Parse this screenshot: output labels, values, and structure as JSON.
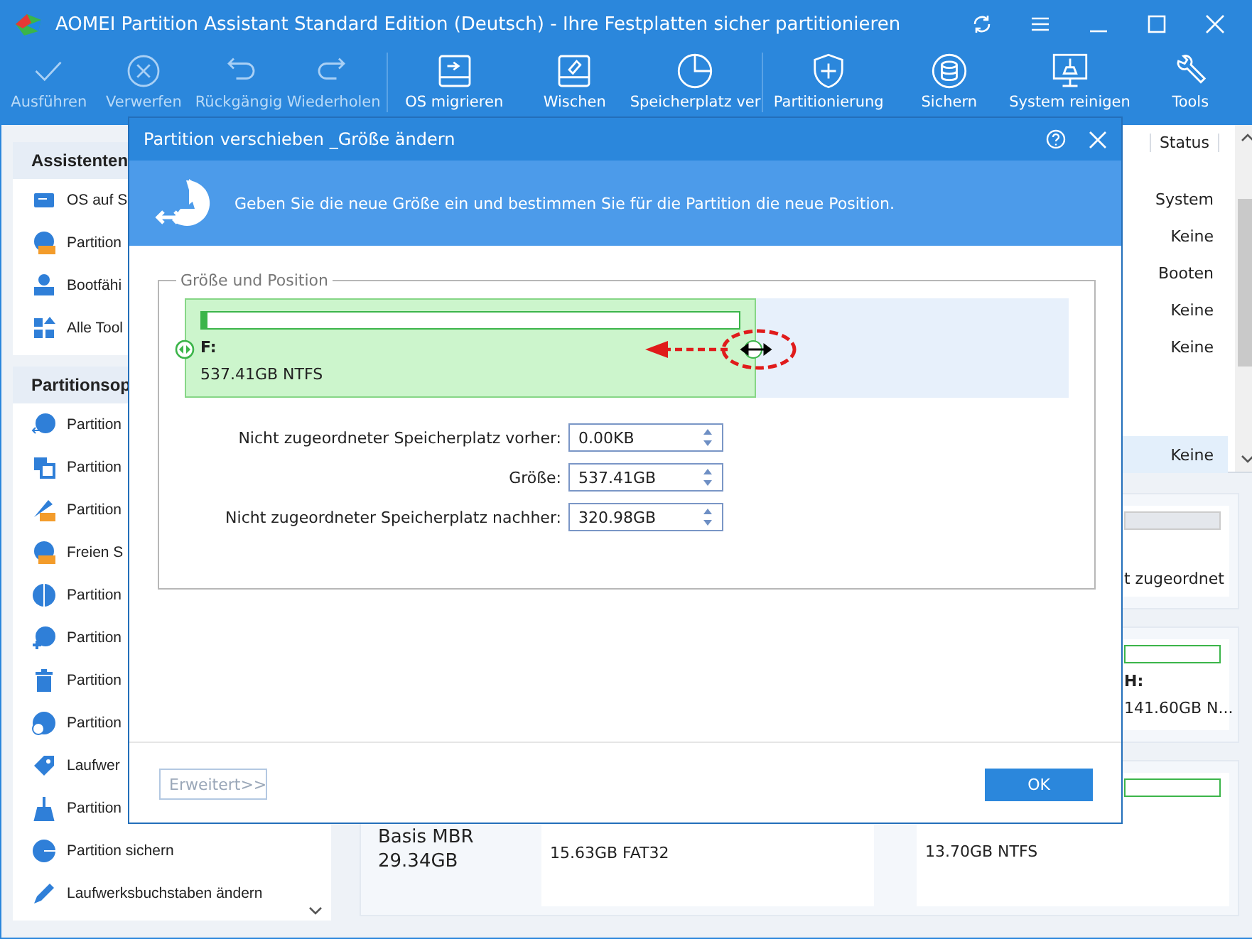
{
  "window": {
    "title": "AOMEI Partition Assistant Standard Edition (Deutsch) - Ihre Festplatten sicher partitionieren"
  },
  "toolbar": [
    {
      "label": "Ausführen",
      "disabled": true
    },
    {
      "label": "Verwerfen",
      "disabled": true
    },
    {
      "label": "Rückgängig",
      "disabled": true
    },
    {
      "label": "Wiederholen",
      "disabled": true
    },
    {
      "label": "OS migrieren",
      "disabled": false
    },
    {
      "label": "Wischen",
      "disabled": false
    },
    {
      "label": "Speicherplatz ver",
      "disabled": false
    },
    {
      "label": "Partitionierung",
      "disabled": false
    },
    {
      "label": "Sichern",
      "disabled": false
    },
    {
      "label": "System reinigen",
      "disabled": false
    },
    {
      "label": "Tools",
      "disabled": false
    }
  ],
  "sidebar": [
    {
      "title": "Assistenten",
      "items": [
        "OS auf S",
        "Partition",
        "Bootfähi",
        "Alle Tool"
      ]
    },
    {
      "title": "Partitionsop",
      "items": [
        "Partition",
        "Partition",
        "Partition",
        "Freien S",
        "Partition",
        "Partition",
        "Partition",
        "Partition",
        "Laufwer",
        "Partition",
        "Partition sichern",
        "Laufwerksbuchstaben ändern"
      ]
    }
  ],
  "table": {
    "columns": [
      "Status"
    ],
    "rows": [
      {
        "status": "System",
        "selected": false
      },
      {
        "status": "Keine",
        "selected": false
      },
      {
        "status": "Booten",
        "selected": false
      },
      {
        "status": "Keine",
        "selected": false
      },
      {
        "status": "Keine",
        "selected": false
      },
      {
        "status": "Keine",
        "selected": true
      }
    ]
  },
  "disks": [
    {
      "partition": {
        "kind": "unallocated",
        "lines": [
          "t zugeordnet"
        ]
      }
    },
    {
      "partition": {
        "kind": "used",
        "lines": [
          "H:",
          "141.60GB N..."
        ]
      }
    },
    {
      "info": [
        "Basis MBR",
        "29.34GB"
      ],
      "partitions": [
        {
          "lines": [
            "15.63GB FAT32"
          ]
        },
        {
          "lines": [
            "13.70GB NTFS"
          ]
        }
      ]
    }
  ],
  "dialog": {
    "title": "Partition verschieben _Größe ändern",
    "header": "Geben Sie die neue Größe ein und bestimmen Sie für die Partition die neue Position.",
    "group": "Größe und Position",
    "partition": {
      "name": "F:",
      "info": "537.41GB NTFS",
      "level": 0.646,
      "usage": {
        "level": 0.01
      }
    },
    "fields": [
      {
        "label": "Nicht zugeordneter Speicherplatz vorher:",
        "value": "0.00KB"
      },
      {
        "label": "Größe:",
        "value": "537.41GB"
      },
      {
        "label": "Nicht zugeordneter Speicherplatz nachher:",
        "value": "320.98GB"
      }
    ],
    "buttons": [
      {
        "label": "Erweitert>>",
        "kind": "secondary",
        "disabled": true
      },
      {
        "label": "OK",
        "kind": "primary",
        "disabled": false
      }
    ]
  }
}
